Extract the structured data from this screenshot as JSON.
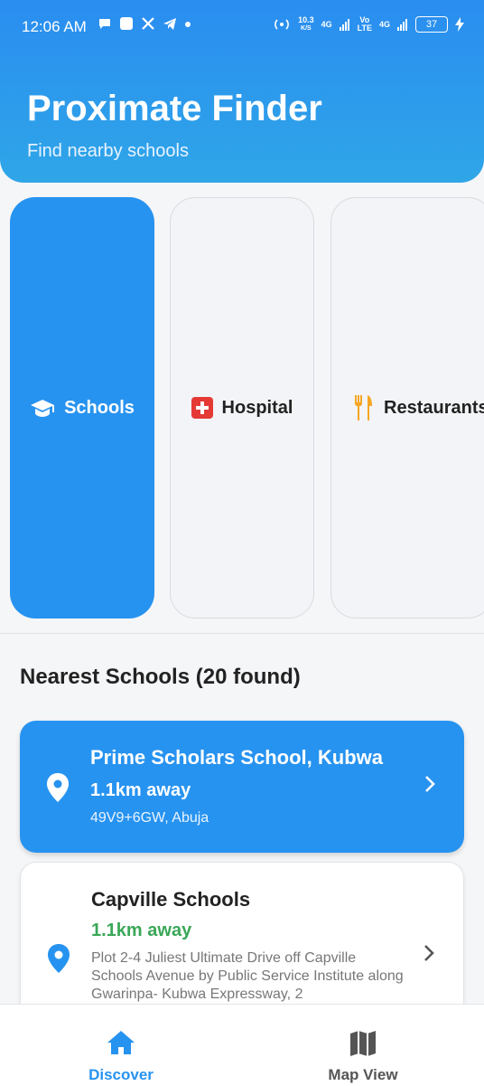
{
  "status_bar": {
    "time": "12:06 AM",
    "speed_value": "10.3",
    "speed_unit": "K/S",
    "net1": "4G",
    "volte_top": "Vo",
    "volte_bottom": "LTE",
    "net2": "4G",
    "battery": "37"
  },
  "header": {
    "title": "Proximate Finder",
    "subtitle": "Find nearby schools",
    "accent_color": "#2793f0"
  },
  "categories": [
    {
      "label": "Schools",
      "icon": "graduation-cap-icon",
      "active": true
    },
    {
      "label": "Hospital",
      "icon": "medical-cross-icon",
      "active": false
    },
    {
      "label": "Restaurants",
      "icon": "fork-knife-icon",
      "active": false
    }
  ],
  "results": {
    "title": "Nearest Schools (20 found)",
    "items": [
      {
        "name": "Prime Scholars School, Kubwa",
        "distance": "1.1km away",
        "address": "49V9+6GW, Abuja"
      },
      {
        "name": "Capville Schools",
        "distance": "1.1km away",
        "address": "Plot 2-4 Juliest Ultimate Drive off Capville Schools Avenue by Public Service Institute along Gwarinpa- Kubwa Expressway, 2"
      }
    ]
  },
  "bottom_nav": {
    "discover": "Discover",
    "map_view": "Map View"
  }
}
